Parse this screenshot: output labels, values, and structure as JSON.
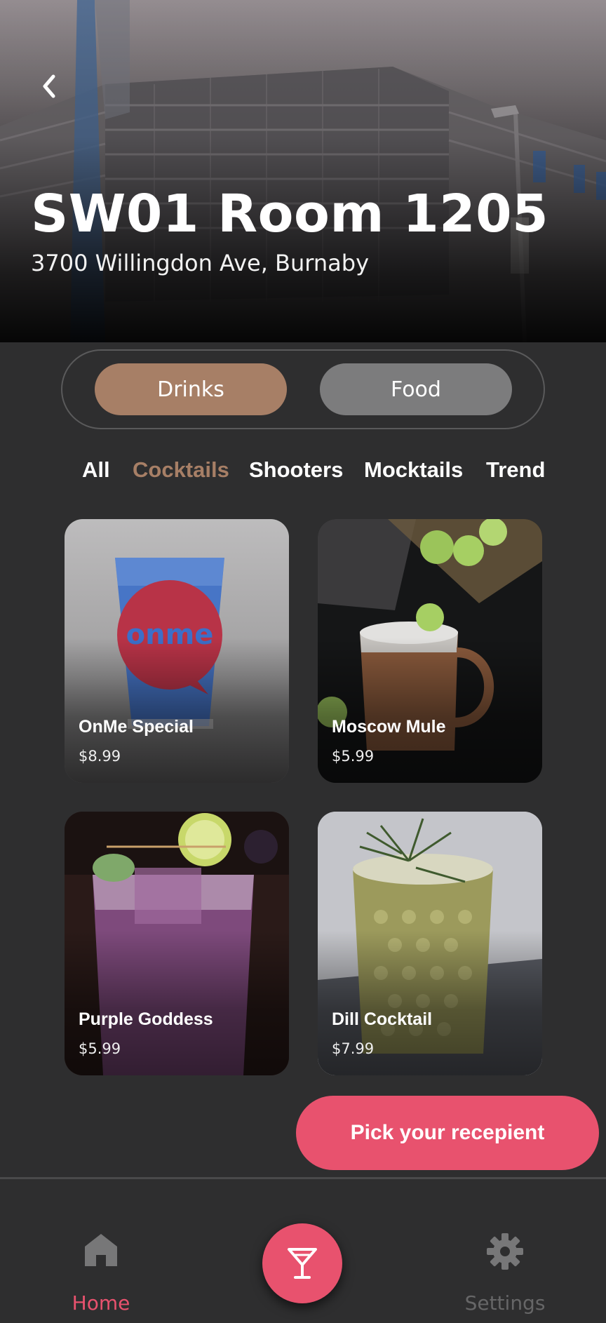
{
  "venue": {
    "title": "SW01 Room 1205",
    "address": "3700 Willingdon Ave, Burnaby"
  },
  "segment": {
    "options": [
      "Drinks",
      "Food"
    ],
    "selected": "Drinks"
  },
  "categories": {
    "items": [
      "All",
      "Cocktails",
      "Shooters",
      "Mocktails",
      "Trend"
    ],
    "selected": "Cocktails"
  },
  "products": [
    {
      "name": "OnMe Special",
      "price": "$8.99",
      "image": "blue-shot-glass-onme-logo"
    },
    {
      "name": "Moscow Mule",
      "price": "$5.99",
      "image": "copper-mug-with-lime"
    },
    {
      "name": "Purple Goddess",
      "price": "$5.99",
      "image": "purple-cocktail-with-mint"
    },
    {
      "name": "Dill Cocktail",
      "price": "$7.99",
      "image": "yellow-cocktail-with-dill"
    }
  ],
  "cta": {
    "label": "Pick your recepient"
  },
  "nav": {
    "home_label": "Home",
    "settings_label": "Settings",
    "home_icon": "home-icon",
    "center_icon": "cocktail-glass-icon",
    "settings_icon": "gear-icon"
  },
  "colors": {
    "accent": "#e8526e",
    "selected": "#a77f66",
    "background": "#2e2e2f",
    "unselected_pill": "#7c7c7d"
  }
}
